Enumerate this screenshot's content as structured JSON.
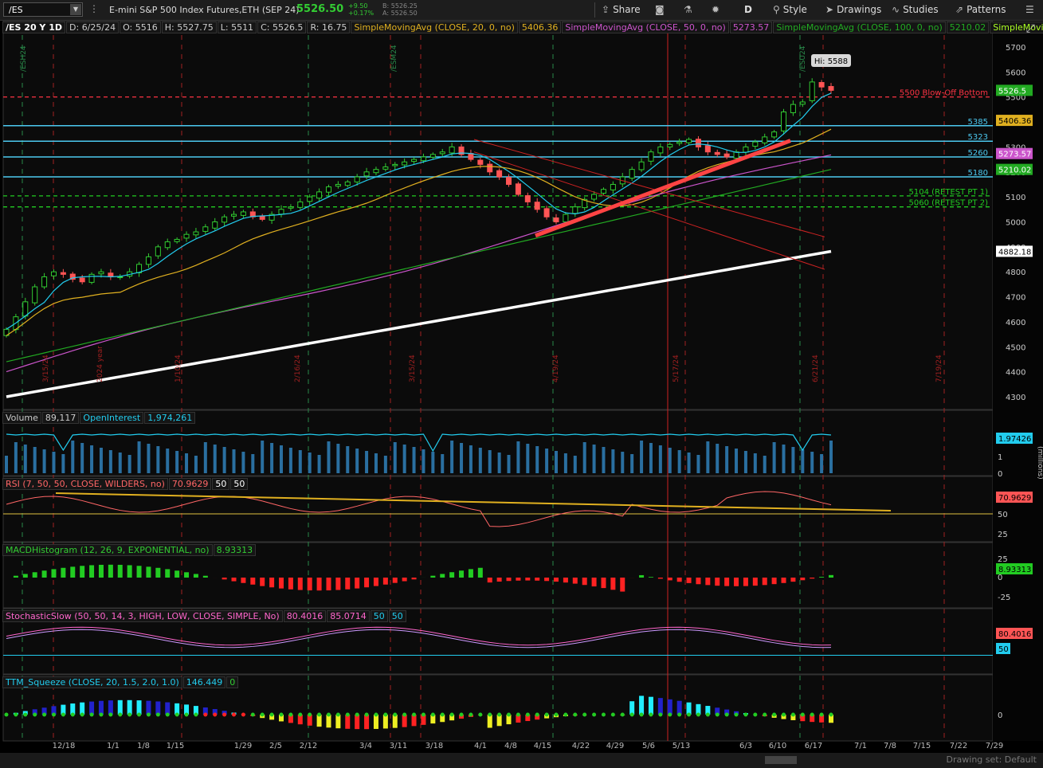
{
  "toolbar": {
    "symbol": "/ES",
    "instrument": "E-mini S&P 500 Index Futures,ETH (SEP 24)",
    "last": "5526.50",
    "change": "+9.50",
    "change_pct": "+0.17%",
    "bid": "B: 5526.25",
    "ask": "A: 5526.50",
    "share": "Share",
    "aggregation": "D",
    "style": "Style",
    "drawings": "Drawings",
    "studies": "Studies",
    "patterns": "Patterns"
  },
  "header": {
    "period": "/ES 20 Y 1D",
    "date": "D: 6/25/24",
    "open": "O: 5516",
    "high": "H: 5527.75",
    "low": "L: 5511",
    "close": "C: 5526.5",
    "range": "R: 16.75",
    "sma20": "SimpleMovingAvg (CLOSE, 20, 0, no)",
    "sma20_val": "5406.36",
    "sma50": "SimpleMovingAvg (CLOSE, 50, 0, no)",
    "sma50_val": "5273.57",
    "sma100": "SimpleMovingAvg (CLOSE, 100, 0, no)",
    "sma100_val": "5210.02",
    "sma200": "SimpleMovingAvg ..."
  },
  "colors": {
    "up": "#33cc33",
    "down": "#ff5555",
    "sma20": "#e0b020",
    "sma50": "#cc55cc",
    "sma100": "#22aa22",
    "sma200": "#ffffff",
    "ema": "#22ccee"
  },
  "price_pane": {
    "axis_ticks": [
      "5700",
      "5600",
      "5500",
      "5400",
      "5300",
      "5200",
      "5100",
      "5000",
      "4900",
      "4800",
      "4700",
      "4600",
      "4500",
      "4400",
      "4300"
    ],
    "hi_label": "Hi: 5588",
    "levels": [
      {
        "price": 5500,
        "label": "5500 Blow-Off Bottom",
        "color": "#ff3344",
        "dash": true
      },
      {
        "price": 5385,
        "label": "5385",
        "color": "#4cc9f0",
        "dash": false
      },
      {
        "price": 5323,
        "label": "5323",
        "color": "#4cc9f0",
        "dash": false
      },
      {
        "price": 5260,
        "label": "5260",
        "color": "#4cc9f0",
        "dash": false
      },
      {
        "price": 5180,
        "label": "5180",
        "color": "#4cc9f0",
        "dash": false
      },
      {
        "price": 5104,
        "label": "5104 (RETEST PT 1)",
        "color": "#22cc22",
        "dash": true
      },
      {
        "price": 5060,
        "label": "5060 (RETEST PT 2)",
        "color": "#22cc22",
        "dash": true
      }
    ],
    "price_tags": [
      {
        "price": 5526.5,
        "label": "5526.5",
        "bg": "#22aa22",
        "fg": "#ffffff"
      },
      {
        "price": 5406.36,
        "label": "5406.36",
        "bg": "#e0b020",
        "fg": "#000000"
      },
      {
        "price": 5273.57,
        "label": "5273.57",
        "bg": "#cc55cc",
        "fg": "#ffffff"
      },
      {
        "price": 5210.02,
        "label": "5210.02",
        "bg": "#22aa22",
        "fg": "#ffffff"
      },
      {
        "price": 4882.18,
        "label": "4882.18",
        "bg": "#ffffff",
        "fg": "#000000"
      }
    ],
    "event_labels": [
      "/ESH24",
      "/ESM24",
      "/ESU24",
      "3/15/24",
      "2024 year",
      "1/10/24",
      "2/16/24",
      "3/15/24",
      "4/19/24",
      "5/17/24",
      "6/21/24",
      "7/19/24"
    ]
  },
  "volume_pane": {
    "label": "Volume",
    "value": "89,117",
    "oi_label": "OpenInterest",
    "oi_value": "1,974,261",
    "axis_ticks": [
      "2",
      "1",
      "0"
    ],
    "tag": "1.97426",
    "unit": "(millions)"
  },
  "rsi_pane": {
    "label": "RSI (7, 50, 50, CLOSE, WILDERS, no)",
    "value": "70.9629",
    "ob": "50",
    "os": "50",
    "axis_ticks": [
      "75",
      "50",
      "25"
    ],
    "tag": "70.9629"
  },
  "macd_pane": {
    "label": "MACDHistogram (12, 26, 9, EXPONENTIAL, no)",
    "value": "8.93313",
    "axis_ticks": [
      "25",
      "0",
      "-25"
    ],
    "tag": "8.93313"
  },
  "stoch_pane": {
    "label": "StochasticSlow (50, 50, 14, 3, HIGH, LOW, CLOSE, SIMPLE, No)",
    "k": "80.4016",
    "d": "85.0714",
    "ob": "50",
    "os": "50",
    "tag_k": "80.4016",
    "tag_mid": "50"
  },
  "ttm_pane": {
    "label": "TTM_Squeeze (CLOSE, 20, 1.5, 2.0, 1.0)",
    "value": "146.449",
    "flag": "0",
    "axis_ticks": [
      "0"
    ]
  },
  "x_axis": [
    "12/18",
    "1/1",
    "1/8",
    "1/15",
    "1/29",
    "2/5",
    "2/12",
    "3/4",
    "3/11",
    "3/18",
    "4/1",
    "4/8",
    "4/15",
    "4/22",
    "4/29",
    "5/6",
    "5/13",
    "6/3",
    "6/10",
    "6/17",
    "7/1",
    "7/8",
    "7/15",
    "7/22",
    "7/29"
  ],
  "footer": {
    "drawing_set": "Drawing set: Default"
  },
  "chart_data": {
    "type": "candlestick",
    "title": "/ES 20 Y 1D",
    "ylabel": "",
    "ylim": [
      4270,
      5760
    ],
    "price_start": 4570,
    "price_end": 5526.5,
    "high": 5588,
    "close_series_approx": [
      4570,
      4620,
      4680,
      4740,
      4780,
      4800,
      4790,
      4770,
      4760,
      4790,
      4800,
      4780,
      4780,
      4800,
      4830,
      4860,
      4900,
      4920,
      4930,
      4950,
      4960,
      4980,
      5000,
      5020,
      5030,
      5040,
      5020,
      5010,
      5030,
      5050,
      5060,
      5080,
      5100,
      5120,
      5140,
      5150,
      5160,
      5180,
      5200,
      5210,
      5220,
      5230,
      5240,
      5250,
      5260,
      5270,
      5280,
      5300,
      5270,
      5250,
      5230,
      5200,
      5180,
      5150,
      5110,
      5080,
      5050,
      5020,
      5000,
      5030,
      5060,
      5090,
      5110,
      5130,
      5150,
      5180,
      5210,
      5240,
      5280,
      5300,
      5310,
      5320,
      5330,
      5300,
      5280,
      5270,
      5260,
      5280,
      5300,
      5320,
      5340,
      5360,
      5440,
      5470,
      5480,
      5560,
      5540,
      5526.5
    ],
    "sma_values": {
      "sma20": 5406.36,
      "sma50": 5273.57,
      "sma100": 5210.02,
      "sma200": 4882.18
    },
    "volume_last": 89117,
    "open_interest_last": 1974261,
    "rsi_last": 70.9629,
    "macd_hist_last": 8.93313,
    "stoch_k": 80.4016,
    "stoch_d": 85.0714,
    "ttm_last": 146.449
  }
}
